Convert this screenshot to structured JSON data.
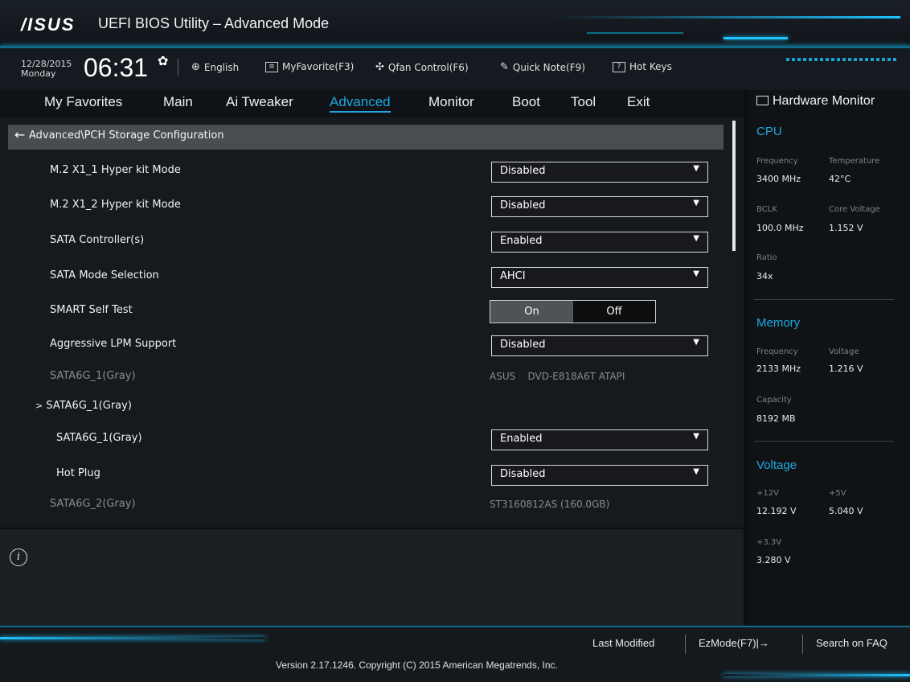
{
  "app": {
    "logo": "/ISUS",
    "title": "UEFI BIOS Utility – Advanced Mode"
  },
  "infobar": {
    "date": "12/28/2015",
    "day": "Monday",
    "time": "06:31",
    "language": "English",
    "myfavorite": "MyFavorite(F3)",
    "qfan": "Qfan Control(F6)",
    "quicknote": "Quick Note(F9)",
    "hotkeys": "Hot Keys"
  },
  "nav": {
    "items": [
      "My Favorites",
      "Main",
      "Ai Tweaker",
      "Advanced",
      "Monitor",
      "Boot",
      "Tool",
      "Exit"
    ],
    "active": "Advanced"
  },
  "breadcrumb": "Advanced\\PCH Storage Configuration",
  "settings": {
    "m2_1": {
      "label": "M.2 X1_1 Hyper kit Mode",
      "value": "Disabled"
    },
    "m2_2": {
      "label": "M.2 X1_2 Hyper kit Mode",
      "value": "Disabled"
    },
    "sata_ctrl": {
      "label": "SATA Controller(s)",
      "value": "Enabled"
    },
    "sata_mode": {
      "label": "SATA Mode Selection",
      "value": "AHCI"
    },
    "smart": {
      "label": "SMART Self Test",
      "on": "On",
      "off": "Off"
    },
    "lpm": {
      "label": "Aggressive LPM Support",
      "value": "Disabled"
    },
    "sata1_info": {
      "label": "SATA6G_1(Gray)",
      "value": "ASUS    DVD-E818A6T ATAPI"
    },
    "sata1_sub": {
      "label": "SATA6G_1(Gray)"
    },
    "sata1_port": {
      "label": "SATA6G_1(Gray)",
      "value": "Enabled"
    },
    "hotplug": {
      "label": "Hot Plug",
      "value": "Disabled"
    },
    "sata2_info": {
      "label": "SATA6G_2(Gray)",
      "value": "ST3160812AS (160.0GB)"
    }
  },
  "hw": {
    "title": "Hardware Monitor",
    "cpu": {
      "title": "CPU",
      "freq_lbl": "Frequency",
      "freq": "3400 MHz",
      "temp_lbl": "Temperature",
      "temp": "42°C",
      "bclk_lbl": "BCLK",
      "bclk": "100.0 MHz",
      "cv_lbl": "Core Voltage",
      "cv": "1.152 V",
      "ratio_lbl": "Ratio",
      "ratio": "34x"
    },
    "memory": {
      "title": "Memory",
      "freq_lbl": "Frequency",
      "freq": "2133 MHz",
      "volt_lbl": "Voltage",
      "volt": "1.216 V",
      "cap_lbl": "Capacity",
      "cap": "8192 MB"
    },
    "voltage": {
      "title": "Voltage",
      "v12_lbl": "+12V",
      "v12": "12.192 V",
      "v5_lbl": "+5V",
      "v5": "5.040 V",
      "v33_lbl": "+3.3V",
      "v33": "3.280 V"
    }
  },
  "footer": {
    "last_modified": "Last Modified",
    "ezmode": "EzMode(F7)|→",
    "search": "Search on FAQ",
    "version": "Version 2.17.1246. Copyright (C) 2015 American Megatrends, Inc."
  },
  "colors": {
    "accent": "#1fa8df",
    "background": "#16191d"
  }
}
